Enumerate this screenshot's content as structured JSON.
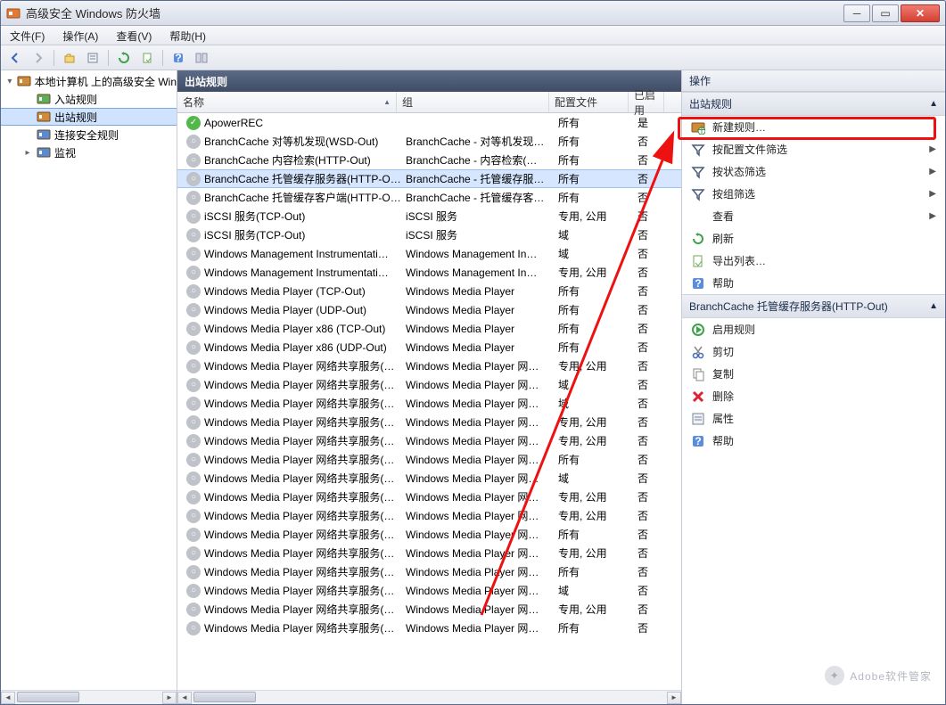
{
  "window": {
    "title": "高级安全 Windows 防火墙"
  },
  "menubar": [
    {
      "label": "文件(F)"
    },
    {
      "label": "操作(A)"
    },
    {
      "label": "查看(V)"
    },
    {
      "label": "帮助(H)"
    }
  ],
  "toolbar_icons": [
    "back",
    "forward",
    "up",
    "props",
    "refresh",
    "export",
    "help",
    "panes"
  ],
  "tree": {
    "root": "本地计算机 上的高级安全 Win",
    "items": [
      {
        "icon": "inbound",
        "label": "入站规则"
      },
      {
        "icon": "outbound",
        "label": "出站规则",
        "selected": true
      },
      {
        "icon": "connsec",
        "label": "连接安全规则"
      },
      {
        "icon": "monitor",
        "label": "监视",
        "expandable": true
      }
    ]
  },
  "mid": {
    "header": "出站规则",
    "columns": {
      "name": "名称",
      "group": "组",
      "profile": "配置文件",
      "enabled": "已启用"
    },
    "rules": [
      {
        "on": true,
        "name": "ApowerREC",
        "group": "",
        "profile": "所有",
        "enabled": "是"
      },
      {
        "on": false,
        "name": "BranchCache 对等机发现(WSD-Out)",
        "group": "BranchCache - 对等机发现…",
        "profile": "所有",
        "enabled": "否"
      },
      {
        "on": false,
        "name": "BranchCache 内容检索(HTTP-Out)",
        "group": "BranchCache - 内容检索(…",
        "profile": "所有",
        "enabled": "否"
      },
      {
        "on": false,
        "sel": true,
        "name": "BranchCache 托管缓存服务器(HTTP-O…",
        "group": "BranchCache - 托管缓存服…",
        "profile": "所有",
        "enabled": "否"
      },
      {
        "on": false,
        "name": "BranchCache 托管缓存客户端(HTTP-O…",
        "group": "BranchCache - 托管缓存客…",
        "profile": "所有",
        "enabled": "否"
      },
      {
        "on": false,
        "name": "iSCSI 服务(TCP-Out)",
        "group": "iSCSI 服务",
        "profile": "专用, 公用",
        "enabled": "否"
      },
      {
        "on": false,
        "name": "iSCSI 服务(TCP-Out)",
        "group": "iSCSI 服务",
        "profile": "域",
        "enabled": "否"
      },
      {
        "on": false,
        "name": "Windows Management Instrumentati…",
        "group": "Windows Management In…",
        "profile": "域",
        "enabled": "否"
      },
      {
        "on": false,
        "name": "Windows Management Instrumentati…",
        "group": "Windows Management In…",
        "profile": "专用, 公用",
        "enabled": "否"
      },
      {
        "on": false,
        "name": "Windows Media Player (TCP-Out)",
        "group": "Windows Media Player",
        "profile": "所有",
        "enabled": "否"
      },
      {
        "on": false,
        "name": "Windows Media Player (UDP-Out)",
        "group": "Windows Media Player",
        "profile": "所有",
        "enabled": "否"
      },
      {
        "on": false,
        "name": "Windows Media Player x86 (TCP-Out)",
        "group": "Windows Media Player",
        "profile": "所有",
        "enabled": "否"
      },
      {
        "on": false,
        "name": "Windows Media Player x86 (UDP-Out)",
        "group": "Windows Media Player",
        "profile": "所有",
        "enabled": "否"
      },
      {
        "on": false,
        "name": "Windows Media Player 网络共享服务(…",
        "group": "Windows Media Player 网…",
        "profile": "专用, 公用",
        "enabled": "否"
      },
      {
        "on": false,
        "name": "Windows Media Player 网络共享服务(…",
        "group": "Windows Media Player 网…",
        "profile": "域",
        "enabled": "否"
      },
      {
        "on": false,
        "name": "Windows Media Player 网络共享服务(…",
        "group": "Windows Media Player 网…",
        "profile": "域",
        "enabled": "否"
      },
      {
        "on": false,
        "name": "Windows Media Player 网络共享服务(…",
        "group": "Windows Media Player 网…",
        "profile": "专用, 公用",
        "enabled": "否"
      },
      {
        "on": false,
        "name": "Windows Media Player 网络共享服务(…",
        "group": "Windows Media Player 网…",
        "profile": "专用, 公用",
        "enabled": "否"
      },
      {
        "on": false,
        "name": "Windows Media Player 网络共享服务(…",
        "group": "Windows Media Player 网…",
        "profile": "所有",
        "enabled": "否"
      },
      {
        "on": false,
        "name": "Windows Media Player 网络共享服务(…",
        "group": "Windows Media Player 网…",
        "profile": "域",
        "enabled": "否"
      },
      {
        "on": false,
        "name": "Windows Media Player 网络共享服务(…",
        "group": "Windows Media Player 网…",
        "profile": "专用, 公用",
        "enabled": "否"
      },
      {
        "on": false,
        "name": "Windows Media Player 网络共享服务(…",
        "group": "Windows Media Player 网…",
        "profile": "专用, 公用",
        "enabled": "否"
      },
      {
        "on": false,
        "name": "Windows Media Player 网络共享服务(…",
        "group": "Windows Media Player 网…",
        "profile": "所有",
        "enabled": "否"
      },
      {
        "on": false,
        "name": "Windows Media Player 网络共享服务(…",
        "group": "Windows Media Player 网…",
        "profile": "专用, 公用",
        "enabled": "否"
      },
      {
        "on": false,
        "name": "Windows Media Player 网络共享服务(…",
        "group": "Windows Media Player 网…",
        "profile": "所有",
        "enabled": "否"
      },
      {
        "on": false,
        "name": "Windows Media Player 网络共享服务(…",
        "group": "Windows Media Player 网…",
        "profile": "域",
        "enabled": "否"
      },
      {
        "on": false,
        "name": "Windows Media Player 网络共享服务(…",
        "group": "Windows Media Player 网…",
        "profile": "专用, 公用",
        "enabled": "否"
      },
      {
        "on": false,
        "name": "Windows Media Player 网络共享服务(…",
        "group": "Windows Media Player 网…",
        "profile": "所有",
        "enabled": "否"
      }
    ]
  },
  "right": {
    "header": "操作",
    "section1": {
      "title": "出站规则",
      "items": [
        {
          "icon": "new-rule",
          "label": "新建规则…",
          "highlighted": true
        },
        {
          "icon": "filter",
          "label": "按配置文件筛选",
          "sub": true
        },
        {
          "icon": "filter",
          "label": "按状态筛选",
          "sub": true
        },
        {
          "icon": "filter",
          "label": "按组筛选",
          "sub": true
        },
        {
          "icon": "blank",
          "label": "查看",
          "sub": true
        },
        {
          "icon": "refresh",
          "label": "刷新"
        },
        {
          "icon": "export",
          "label": "导出列表…"
        },
        {
          "icon": "help",
          "label": "帮助"
        }
      ]
    },
    "section2": {
      "title": "BranchCache 托管缓存服务器(HTTP-Out)",
      "items": [
        {
          "icon": "enable",
          "label": "启用规则"
        },
        {
          "icon": "cut",
          "label": "剪切"
        },
        {
          "icon": "copy",
          "label": "复制"
        },
        {
          "icon": "delete",
          "label": "删除"
        },
        {
          "icon": "props",
          "label": "属性"
        },
        {
          "icon": "help",
          "label": "帮助"
        }
      ]
    }
  },
  "watermark": "Adobe软件管家"
}
